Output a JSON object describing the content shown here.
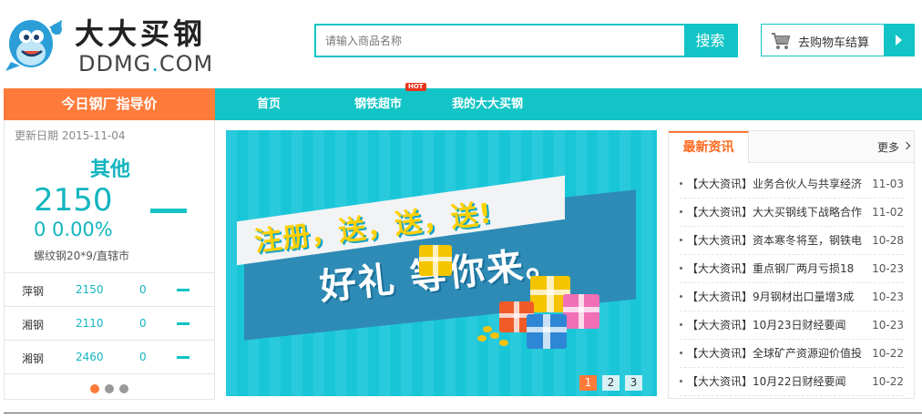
{
  "header": {
    "logo_cn": "大大买钢",
    "logo_en_part1": "DDMG",
    "logo_en_dot": ".",
    "logo_en_part2": "COM",
    "search_placeholder": "请输入商品名称",
    "search_button": "搜索",
    "cart_label": "去购物车结算"
  },
  "nav": {
    "guide_label": "今日钢厂指导价",
    "items": [
      {
        "label": "首页"
      },
      {
        "label": "钢铁超市",
        "badge": "HOT"
      },
      {
        "label": "我的大大买钢"
      }
    ]
  },
  "price_panel": {
    "date_label": "更新日期 2015-11-04",
    "kind": "其他",
    "price": "2150",
    "change": "0  0.00%",
    "spec": "螺纹钢20*9/直辖市",
    "rows": [
      {
        "name": "萍钢",
        "price": "2150",
        "change": "0"
      },
      {
        "name": "湘钢",
        "price": "2110",
        "change": "0"
      },
      {
        "name": "湘钢",
        "price": "2460",
        "change": "0"
      }
    ]
  },
  "banner": {
    "line1": "注册，送，送，送!",
    "line2": "好礼  等你来。",
    "pages": [
      "1",
      "2",
      "3"
    ],
    "active_page": "1"
  },
  "news": {
    "tab_label": "最新资讯",
    "more_label": "更多",
    "items": [
      {
        "title": "【大大资讯】业务合伙人与共享经济",
        "date": "11-03"
      },
      {
        "title": "【大大资讯】大大买钢线下战略合作",
        "date": "11-02"
      },
      {
        "title": "【大大资讯】资本寒冬将至，钢铁电",
        "date": "10-28"
      },
      {
        "title": "【大大资讯】重点钢厂两月亏损18",
        "date": "10-23"
      },
      {
        "title": "【大大资讯】9月钢材出口量增3成",
        "date": "10-23"
      },
      {
        "title": "【大大资讯】10月23日财经要闻",
        "date": "10-23"
      },
      {
        "title": "【大大资讯】全球矿产资源迎价值投",
        "date": "10-22"
      },
      {
        "title": "【大大资讯】10月22日财经要闻",
        "date": "10-22"
      }
    ]
  },
  "colors": {
    "accent": "#12c4c5",
    "orange": "#ff7b3a"
  }
}
